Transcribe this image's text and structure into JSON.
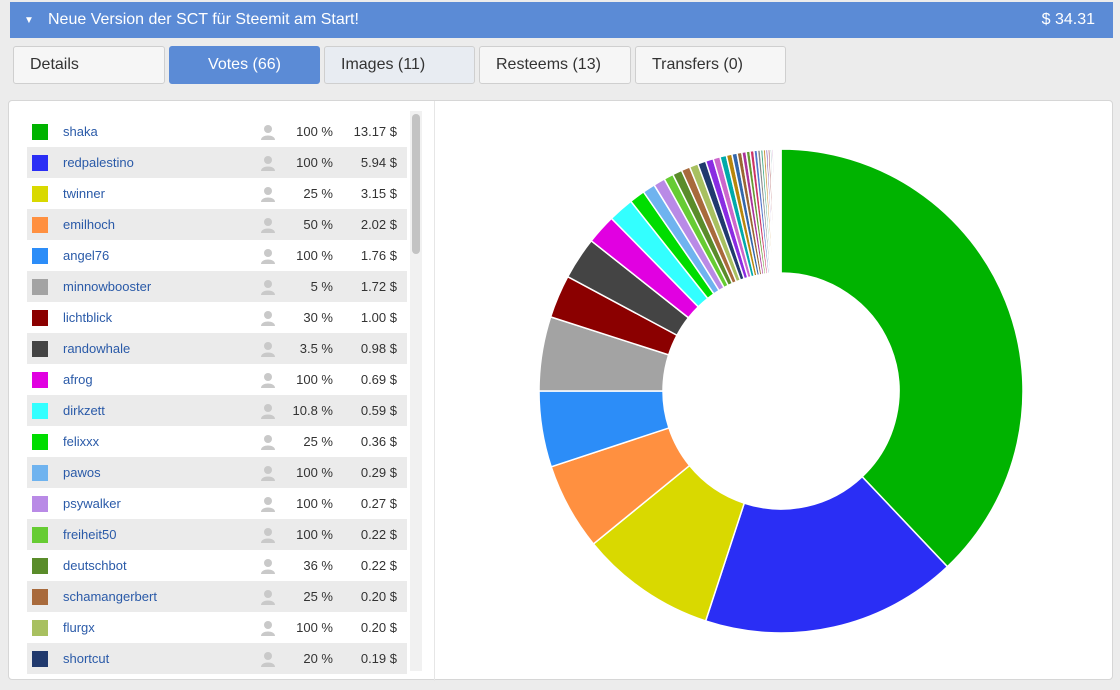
{
  "header": {
    "title": "Neue Version der SCT für Steemit am Start!",
    "amount": "$ 34.31"
  },
  "tabs": [
    {
      "label": "Details"
    },
    {
      "label": "Votes (66)"
    },
    {
      "label": "Images (11)"
    },
    {
      "label": "Resteems (13)"
    },
    {
      "label": "Transfers (0)"
    }
  ],
  "votes": [
    {
      "name": "shaka",
      "percent": "100 %",
      "value": "13.17 $",
      "color": "#00b300"
    },
    {
      "name": "redpalestino",
      "percent": "100 %",
      "value": "5.94 $",
      "color": "#2a2ef5"
    },
    {
      "name": "twinner",
      "percent": "25 %",
      "value": "3.15 $",
      "color": "#d9d900"
    },
    {
      "name": "emilhoch",
      "percent": "50 %",
      "value": "2.02 $",
      "color": "#ff9040"
    },
    {
      "name": "angel76",
      "percent": "100 %",
      "value": "1.76 $",
      "color": "#2c8df8"
    },
    {
      "name": "minnowbooster",
      "percent": "5 %",
      "value": "1.72 $",
      "color": "#a3a3a3"
    },
    {
      "name": "lichtblick",
      "percent": "30 %",
      "value": "1.00 $",
      "color": "#8b0000"
    },
    {
      "name": "randowhale",
      "percent": "3.5 %",
      "value": "0.98 $",
      "color": "#444444"
    },
    {
      "name": "afrog",
      "percent": "100 %",
      "value": "0.69 $",
      "color": "#e100e1"
    },
    {
      "name": "dirkzett",
      "percent": "10.8 %",
      "value": "0.59 $",
      "color": "#33ffff"
    },
    {
      "name": "felixxx",
      "percent": "25 %",
      "value": "0.36 $",
      "color": "#00dd00"
    },
    {
      "name": "pawos",
      "percent": "100 %",
      "value": "0.29 $",
      "color": "#6fb3ef"
    },
    {
      "name": "psywalker",
      "percent": "100 %",
      "value": "0.27 $",
      "color": "#b98ae6"
    },
    {
      "name": "freiheit50",
      "percent": "100 %",
      "value": "0.22 $",
      "color": "#66cc33"
    },
    {
      "name": "deutschbot",
      "percent": "36 %",
      "value": "0.22 $",
      "color": "#5a8c2a"
    },
    {
      "name": "schamangerbert",
      "percent": "25 %",
      "value": "0.20 $",
      "color": "#a86a3c"
    },
    {
      "name": "flurgx",
      "percent": "100 %",
      "value": "0.20 $",
      "color": "#a8c060"
    },
    {
      "name": "shortcut",
      "percent": "20 %",
      "value": "0.19 $",
      "color": "#213a6e"
    }
  ],
  "chart_data": {
    "type": "pie",
    "style": "donut",
    "categories": [
      "shaka",
      "redpalestino",
      "twinner",
      "emilhoch",
      "angel76",
      "minnowbooster",
      "lichtblick",
      "randowhale",
      "afrog",
      "dirkzett",
      "felixxx",
      "pawos",
      "psywalker",
      "freiheit50",
      "deutschbot",
      "schamangerbert",
      "flurgx",
      "shortcut"
    ],
    "values": [
      13.17,
      5.94,
      3.15,
      2.02,
      1.76,
      1.72,
      1.0,
      0.98,
      0.69,
      0.59,
      0.36,
      0.29,
      0.27,
      0.22,
      0.22,
      0.2,
      0.2,
      0.19
    ],
    "other_values": [
      0.18,
      0.16,
      0.15,
      0.13,
      0.12,
      0.11,
      0.1,
      0.09,
      0.09,
      0.08,
      0.07,
      0.06,
      0.06,
      0.05,
      0.05,
      0.04,
      0.04,
      0.03,
      0.03,
      0.02,
      0.02,
      0.02,
      0.02,
      0.01,
      0.01,
      0.01
    ],
    "other_colors": [
      "#8a2be2",
      "#cc66cc",
      "#00aaaa",
      "#b8860b",
      "#3366aa",
      "#996633",
      "#aa3399",
      "#669933",
      "#cc3366",
      "#5577cc",
      "#888888",
      "#44aa88",
      "#cc9944",
      "#7744aa",
      "#aa5555",
      "#337777",
      "#bb77bb",
      "#999933",
      "#6688bb",
      "#aa6644",
      "#55aa55",
      "#aa44aa",
      "#4477aa",
      "#aaaa55",
      "#777777",
      "#cc8866"
    ],
    "total": 34.31
  }
}
